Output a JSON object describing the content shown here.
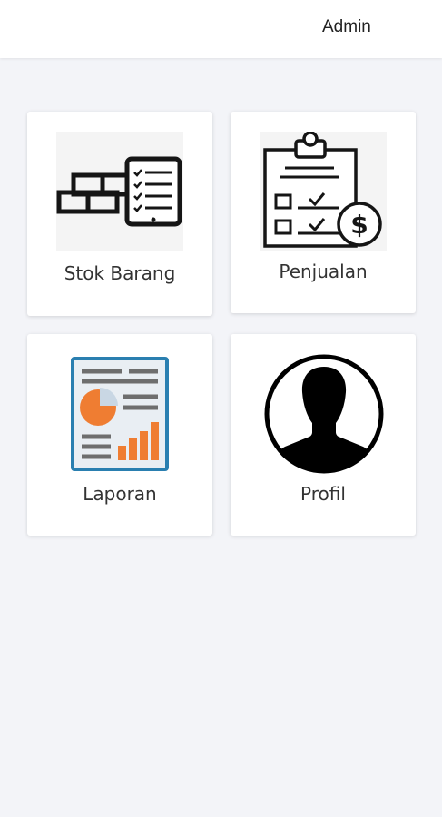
{
  "header": {
    "user_label": "Admin"
  },
  "menu": {
    "items": [
      {
        "label": "Stok Barang",
        "icon": "stock-icon"
      },
      {
        "label": "Penjualan",
        "icon": "sales-clipboard-icon"
      },
      {
        "label": "Laporan",
        "icon": "report-icon"
      },
      {
        "label": "Profil",
        "icon": "profile-avatar-icon"
      }
    ]
  },
  "colors": {
    "background": "#f3f4f8",
    "card": "#ffffff",
    "report_frame": "#2a7fb0",
    "report_orange": "#ef7d32"
  }
}
